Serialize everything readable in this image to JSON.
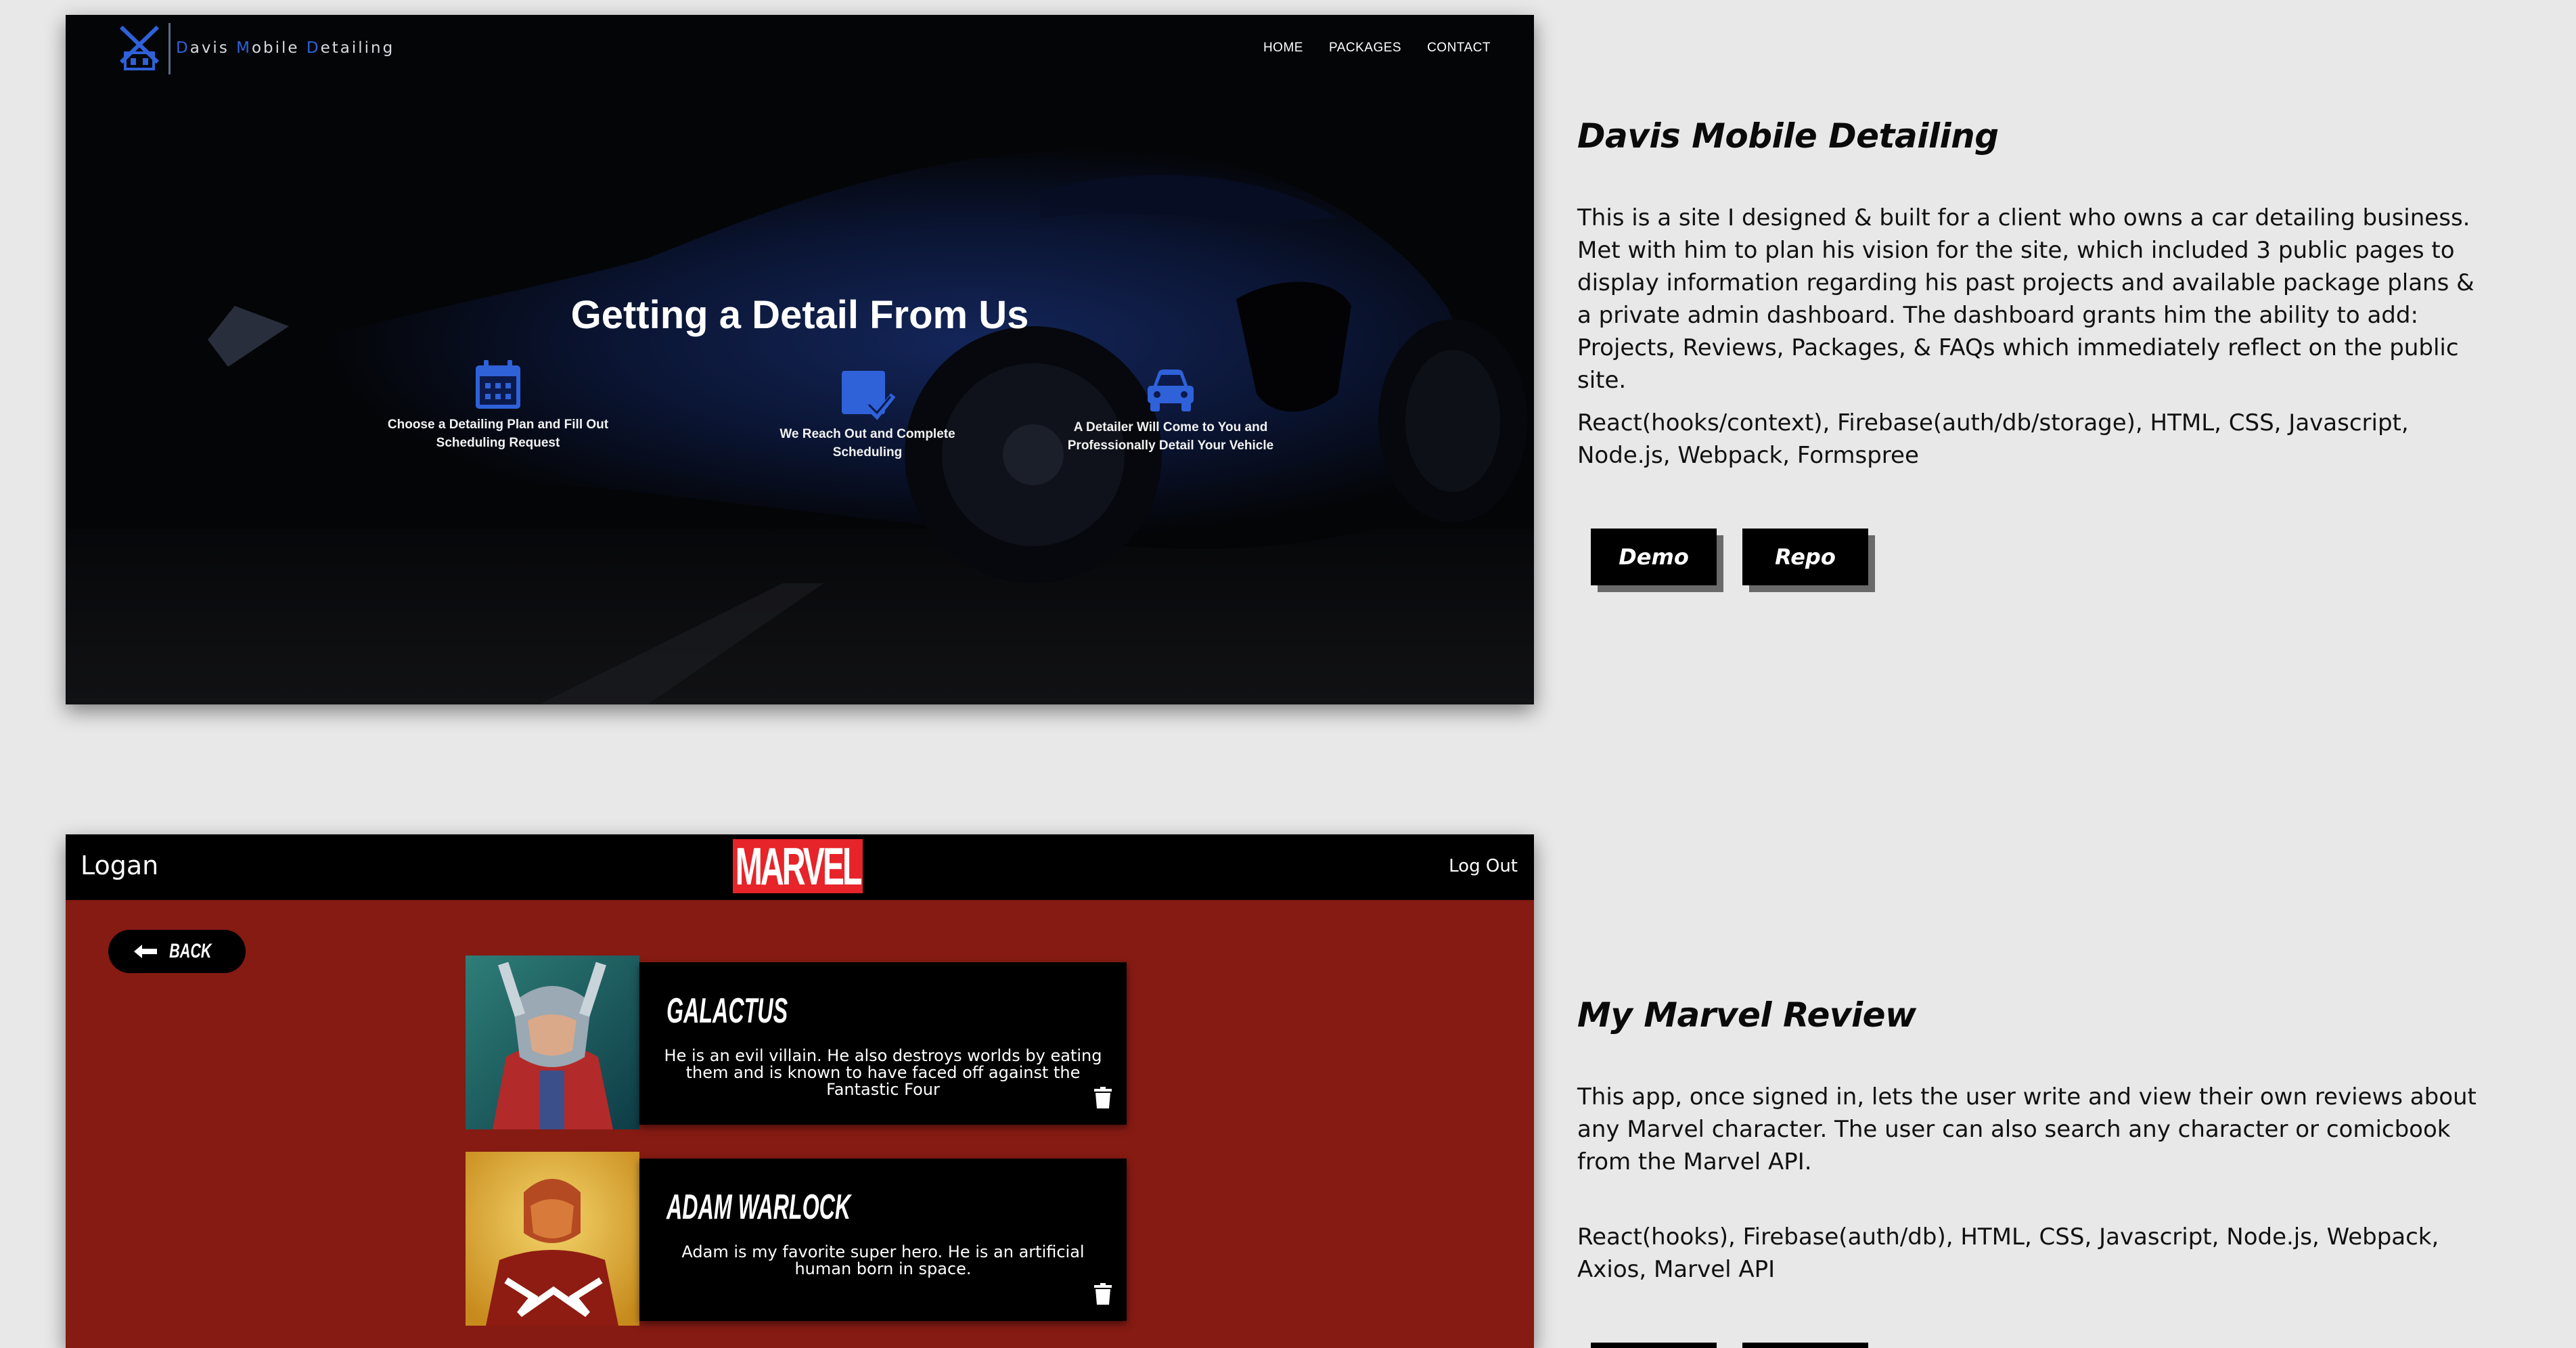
{
  "projects": [
    {
      "title": "Davis Mobile Detailing",
      "description": "This is a site I designed & built for a client who owns a car detailing business. Met with him to plan his vision for the site, which included 3 public pages to display information regarding his past projects and available package plans & a private admin dashboard. The dashboard grants him the ability to add: Projects, Reviews, Packages, & FAQs which immediately reflect on the public site.",
      "tech": "React(hooks/context), Firebase(auth/db/storage), HTML, CSS, Javascript, Node.js, Webpack, Formspree",
      "buttons": {
        "demo": "Demo",
        "repo": "Repo"
      },
      "screenshot": {
        "brand_letters": [
          "D",
          "avis ",
          "M",
          "obile ",
          "D",
          "etailing"
        ],
        "nav": [
          "HOME",
          "PACKAGES",
          "CONTACT"
        ],
        "hero_title": "Getting a Detail From Us",
        "steps": [
          {
            "icon": "calendar-icon",
            "text": "Choose a Detailing Plan and Fill Out Scheduling Request"
          },
          {
            "icon": "checked-box-icon",
            "text": "We Reach Out and Complete Scheduling"
          },
          {
            "icon": "car-icon",
            "text": "A Detailer Will Come to You and Professionally Detail Your Vehicle"
          }
        ]
      }
    },
    {
      "title": "My Marvel Review",
      "description": "This app, once signed in, lets the user write and view their own reviews about any Marvel character. The user can also search any character or comicbook from the Marvel API.",
      "tech": "React(hooks), Firebase(auth/db), HTML, CSS, Javascript, Node.js, Webpack, Axios, Marvel API",
      "screenshot": {
        "user": "Logan",
        "logo": "MARVEL",
        "logout": "Log Out",
        "back": "BACK",
        "reviews": [
          {
            "name": "GALACTUS",
            "text": "He is an evil villain. He also destroys worlds by eating them and is known to have faced off against the Fantastic Four"
          },
          {
            "name": "ADAM WARLOCK",
            "text": "Adam is my favorite super hero. He is an artificial human born in space."
          }
        ]
      }
    }
  ],
  "colors": {
    "page_bg": "#e8e8e8",
    "marvel_red": "#e62429",
    "marvel_bg": "#851b13",
    "dmd_blue": "#2f61d9",
    "button_shadow": "#6a6a6a"
  }
}
